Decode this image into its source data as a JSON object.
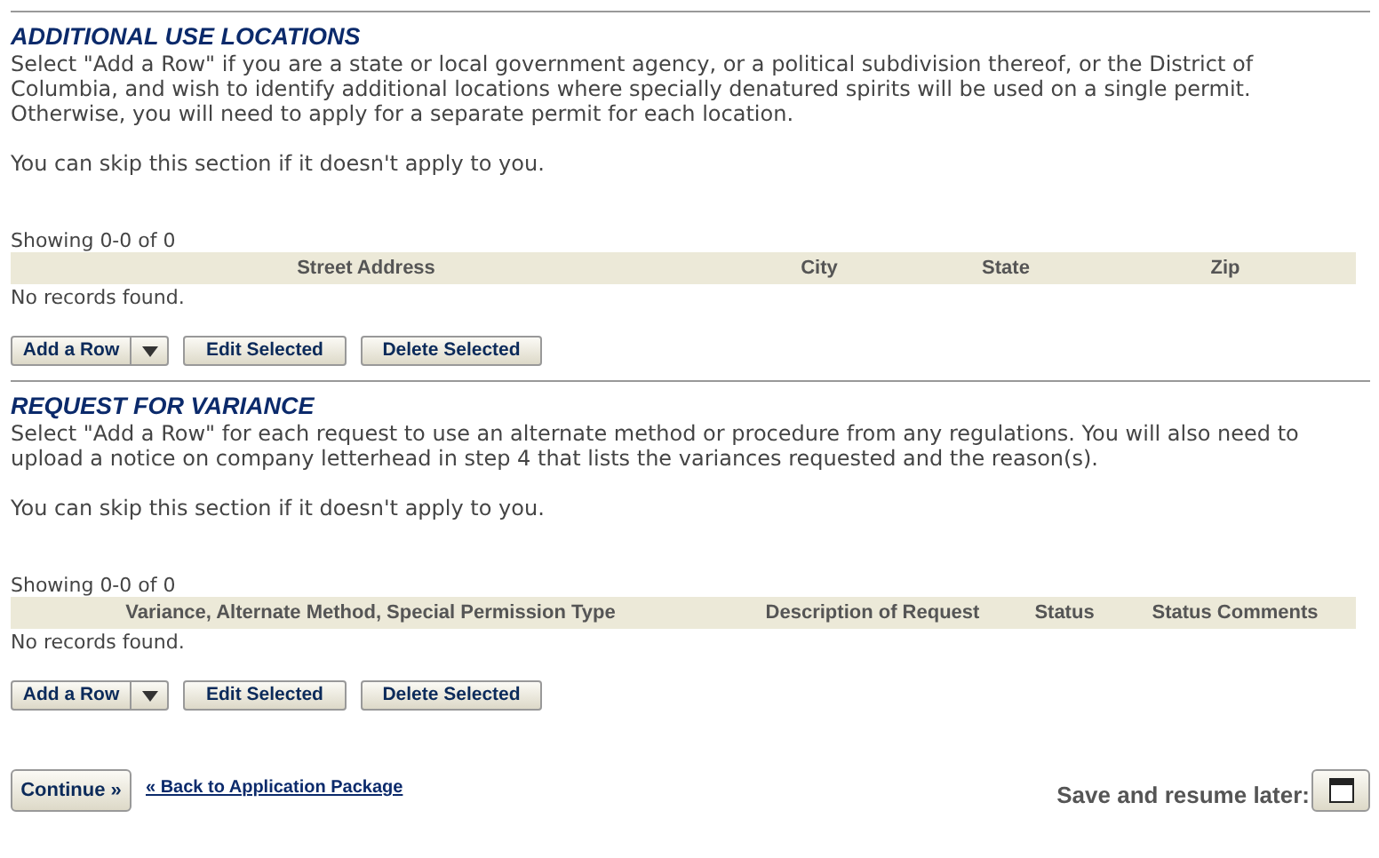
{
  "sections": [
    {
      "title": "ADDITIONAL USE LOCATIONS",
      "description": "Select \"Add a Row\" if you are a state or local government agency, or a political subdivision thereof, or the District of Columbia, and wish to identify additional locations where specially denatured spirits will be used on a single permit. Otherwise, you will need to apply for a separate permit for each location.",
      "skip_note": "You can skip this section if it doesn't apply to you.",
      "showing": "Showing 0-0 of 0",
      "columns": [
        "Street Address",
        "City",
        "State",
        "Zip"
      ],
      "empty_message": "No records found.",
      "buttons": [
        "Add a Row",
        "Edit Selected",
        "Delete Selected"
      ]
    },
    {
      "title": "REQUEST FOR VARIANCE",
      "description": "Select \"Add a Row\" for each request to use an alternate method or procedure from any regulations. You will also need to upload a notice on company letterhead in step 4 that lists the variances requested and the reason(s).",
      "skip_note": "You can skip this section if it doesn't apply to you.",
      "showing": "Showing 0-0 of 0",
      "columns": [
        "Variance, Alternate Method, Special Permission Type",
        "Description of Request",
        "Status",
        "Status Comments"
      ],
      "empty_message": "No records found.",
      "buttons": [
        "Add a Row",
        "Edit Selected",
        "Delete Selected"
      ]
    }
  ],
  "footer": {
    "continue_button": "Continue »",
    "back_link": "« Back to Application Package",
    "save_label": "Save and resume later:"
  }
}
